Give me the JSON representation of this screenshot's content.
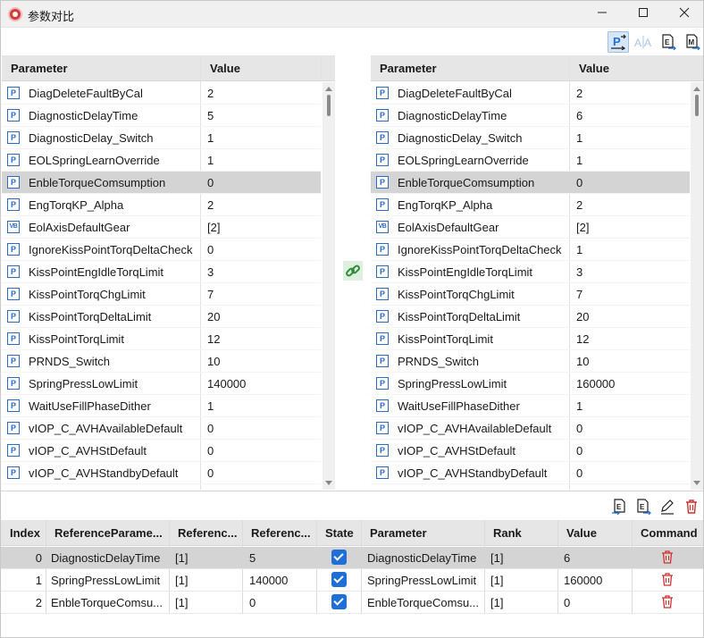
{
  "window": {
    "title": "参数对比"
  },
  "toolbar_top": {
    "icons": [
      "parameter-compare-icon",
      "text-compare-icon",
      "export-icon",
      "markdown-export-icon"
    ]
  },
  "left_grid": {
    "headers": {
      "parameter": "Parameter",
      "value": "Value"
    },
    "rows": [
      {
        "type": "P",
        "name": "DiagDeleteFaultByCal",
        "value": "2"
      },
      {
        "type": "P",
        "name": "DiagnosticDelayTime",
        "value": "5"
      },
      {
        "type": "P",
        "name": "DiagnosticDelay_Switch",
        "value": "1"
      },
      {
        "type": "P",
        "name": "EOLSpringLearnOverride",
        "value": "1"
      },
      {
        "type": "P",
        "name": "EnbleTorqueComsumption",
        "value": "0"
      },
      {
        "type": "P",
        "name": "EngTorqKP_Alpha",
        "value": "2"
      },
      {
        "type": "VB",
        "name": "EolAxisDefaultGear",
        "value": "[2]"
      },
      {
        "type": "P",
        "name": "IgnoreKissPointTorqDeltaCheck",
        "value": "0"
      },
      {
        "type": "P",
        "name": "KissPointEngIdleTorqLimit",
        "value": "3"
      },
      {
        "type": "P",
        "name": "KissPointTorqChgLimit",
        "value": "7"
      },
      {
        "type": "P",
        "name": "KissPointTorqDeltaLimit",
        "value": "20"
      },
      {
        "type": "P",
        "name": "KissPointTorqLimit",
        "value": "12"
      },
      {
        "type": "P",
        "name": "PRNDS_Switch",
        "value": "10"
      },
      {
        "type": "P",
        "name": "SpringPressLowLimit",
        "value": "140000"
      },
      {
        "type": "P",
        "name": "WaitUseFillPhaseDither",
        "value": "1"
      },
      {
        "type": "P",
        "name": "vIOP_C_AVHAvailableDefault",
        "value": "0"
      },
      {
        "type": "P",
        "name": "vIOP_C_AVHStDefault",
        "value": "0"
      },
      {
        "type": "P",
        "name": "vIOP_C_AVHStandbyDefault",
        "value": "0"
      }
    ]
  },
  "right_grid": {
    "headers": {
      "parameter": "Parameter",
      "value": "Value"
    },
    "rows": [
      {
        "type": "P",
        "name": "DiagDeleteFaultByCal",
        "value": "2"
      },
      {
        "type": "P",
        "name": "DiagnosticDelayTime",
        "value": "6"
      },
      {
        "type": "P",
        "name": "DiagnosticDelay_Switch",
        "value": "1"
      },
      {
        "type": "P",
        "name": "EOLSpringLearnOverride",
        "value": "1"
      },
      {
        "type": "P",
        "name": "EnbleTorqueComsumption",
        "value": "0"
      },
      {
        "type": "P",
        "name": "EngTorqKP_Alpha",
        "value": "2"
      },
      {
        "type": "VB",
        "name": "EolAxisDefaultGear",
        "value": "[2]"
      },
      {
        "type": "P",
        "name": "IgnoreKissPointTorqDeltaCheck",
        "value": "1"
      },
      {
        "type": "P",
        "name": "KissPointEngIdleTorqLimit",
        "value": "3"
      },
      {
        "type": "P",
        "name": "KissPointTorqChgLimit",
        "value": "7"
      },
      {
        "type": "P",
        "name": "KissPointTorqDeltaLimit",
        "value": "20"
      },
      {
        "type": "P",
        "name": "KissPointTorqLimit",
        "value": "12"
      },
      {
        "type": "P",
        "name": "PRNDS_Switch",
        "value": "10"
      },
      {
        "type": "P",
        "name": "SpringPressLowLimit",
        "value": "160000"
      },
      {
        "type": "P",
        "name": "WaitUseFillPhaseDither",
        "value": "1"
      },
      {
        "type": "P",
        "name": "vIOP_C_AVHAvailableDefault",
        "value": "0"
      },
      {
        "type": "P",
        "name": "vIOP_C_AVHStDefault",
        "value": "0"
      },
      {
        "type": "P",
        "name": "vIOP_C_AVHStandbyDefault",
        "value": "0"
      }
    ]
  },
  "diff_table": {
    "headers": {
      "index": "Index",
      "ref_param": "ReferenceParame...",
      "ref_rank": "Referenc...",
      "ref_value": "Referenc...",
      "state": "State",
      "parameter": "Parameter",
      "rank": "Rank",
      "value": "Value",
      "command": "Command"
    },
    "rows": [
      {
        "index": "0",
        "ref_param": "DiagnosticDelayTime",
        "ref_rank": "[1]",
        "ref_value": "5",
        "state": true,
        "parameter": "DiagnosticDelayTime",
        "rank": "[1]",
        "value": "6"
      },
      {
        "index": "1",
        "ref_param": "SpringPressLowLimit",
        "ref_rank": "[1]",
        "ref_value": "140000",
        "state": true,
        "parameter": "SpringPressLowLimit",
        "rank": "[1]",
        "value": "160000"
      },
      {
        "index": "2",
        "ref_param": "EnbleTorqueComsu...",
        "ref_rank": "[1]",
        "ref_value": "0",
        "state": true,
        "parameter": "EnbleTorqueComsu...",
        "rank": "[1]",
        "value": "0"
      }
    ]
  },
  "colors": {
    "accent": "#1f6fd6",
    "selection": "#d4d4d4",
    "delete": "#d32f2f",
    "link": "#2e8b3a"
  }
}
